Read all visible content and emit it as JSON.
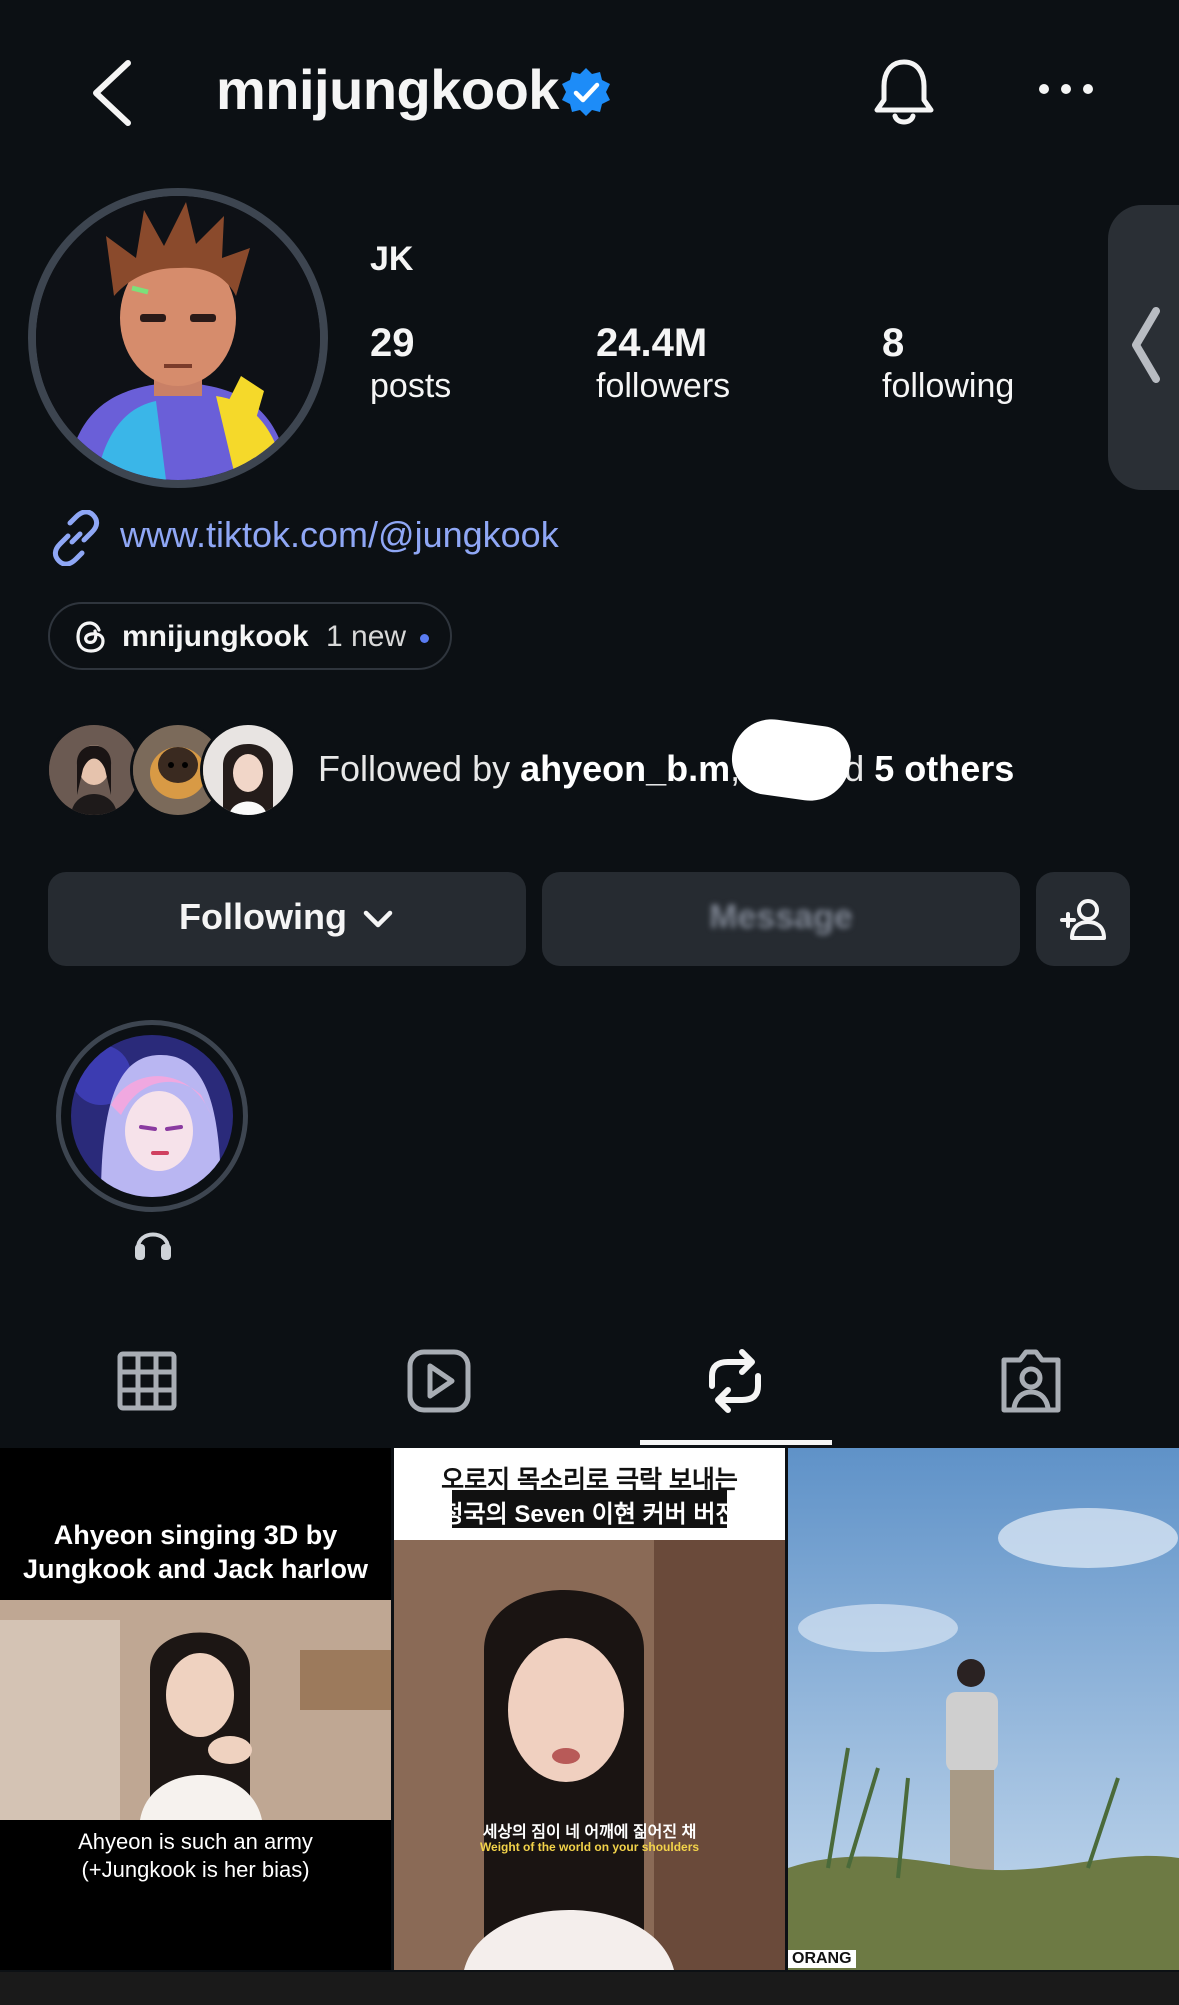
{
  "header": {
    "username": "mnijungkook",
    "verified": true
  },
  "profile": {
    "display_name": "JK",
    "stats": [
      {
        "value": "29",
        "label": "posts"
      },
      {
        "value": "24.4M",
        "label": "followers"
      },
      {
        "value": "8",
        "label": "following"
      }
    ],
    "link": "www.tiktok.com/@jungkook",
    "threads": {
      "name": "mnijungkook",
      "badge": "1 new"
    }
  },
  "followed_by": {
    "prefix": "Followed by ",
    "user": "ahyeon_b.m",
    "separator": ",",
    "mid": "nd ",
    "others": "5 others"
  },
  "actions": {
    "following_label": "Following",
    "message_label": "Message"
  },
  "grid": {
    "tile1_top": "Ahyeon singing 3D by Jungkook and Jack harlow",
    "tile1_bottom_line1": "Ahyeon is such an army",
    "tile1_bottom_line2": "(+Jungkook is her bias)",
    "tile2_top_line1": "오로지 목소리로 극락 보내는",
    "tile2_top_line2": "정국의 Seven 이현 커버 버전",
    "tile2_sub_ko": "세상의 짐이 네 어깨에 짊어진 채",
    "tile2_sub_en": "Weight of the world on your shoulders",
    "tile3_corner": "ORANG"
  },
  "colors": {
    "background": "#0c1014",
    "button": "#262b31",
    "link": "#8fa7f5",
    "verified": "#1d8cf8"
  }
}
